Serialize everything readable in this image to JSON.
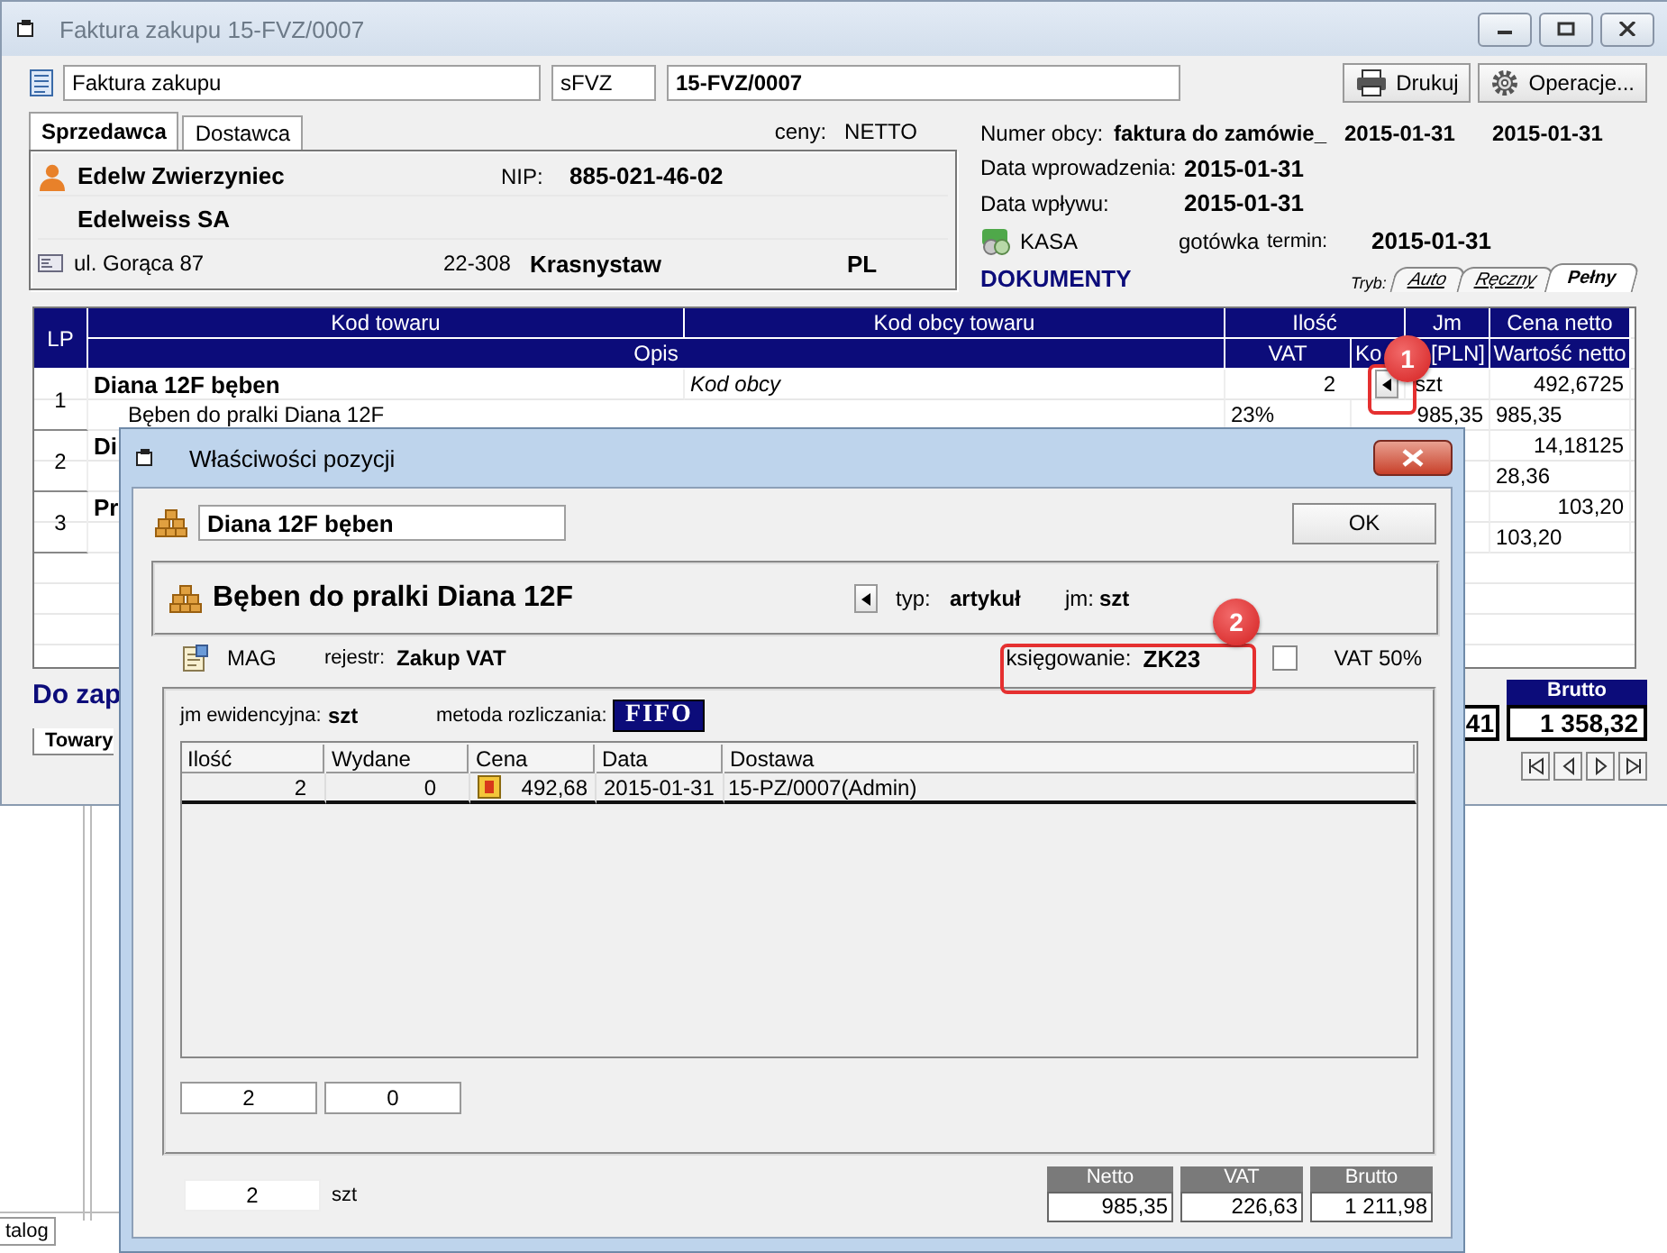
{
  "window": {
    "title": "Faktura zakupu 15-FVZ/0007"
  },
  "header": {
    "doc_type": "Faktura zakupu",
    "series": "sFVZ",
    "number": "15-FVZ/0007",
    "buttons": [
      {
        "kind": "print",
        "label": "Drukuj"
      },
      {
        "kind": "operations",
        "label": "Operacje..."
      }
    ]
  },
  "party_tabs": [
    {
      "label": "Sprzedawca",
      "selected": true
    },
    {
      "label": "Dostawca",
      "selected": false
    }
  ],
  "prices": {
    "label": "ceny:",
    "value": "NETTO"
  },
  "seller": {
    "name": "Edelw Zwierzyniec",
    "nip_label": "NIP:",
    "nip": "885-021-46-02",
    "full_name": "Edelweiss SA",
    "street": "ul. Gorąca 87",
    "postcode": "22-308",
    "city": "Krasnystaw",
    "country": "PL"
  },
  "doc_info": {
    "foreign_label": "Numer obcy:",
    "foreign_number": "faktura do zamówie_",
    "foreign_date_1": "2015-01-31",
    "foreign_date_2": "2015-01-31",
    "entry_label": "Data wprowadzenia:",
    "entry_date": "2015-01-31",
    "receipt_label": "Data wpływu:",
    "receipt_date": "2015-01-31",
    "cash_register": "KASA",
    "payment": "gotówka",
    "due_label": "termin:",
    "due_date": "2015-01-31"
  },
  "documents_label": "DOKUMENTY",
  "mode_label": "Tryb:",
  "mode_tabs": [
    {
      "label": "Auto",
      "selected": false
    },
    {
      "label": "Ręczny",
      "selected": false
    },
    {
      "label": "Pełny",
      "selected": true
    }
  ],
  "table": {
    "columns_top": [
      "LP",
      "Kod towaru",
      "Kod obcy towaru",
      "Ilość",
      "Jm",
      "Cena netto"
    ],
    "columns_bottom": [
      "Opis",
      "VAT",
      {
        "start": "Ko",
        "end": "[PLN]"
      },
      "Wartość netto"
    ],
    "rows": [
      {
        "lp": "1",
        "code": "Diana 12F bęben",
        "foreign_code": "Kod obcy",
        "qty": "2",
        "unit": "szt",
        "price": "492,6725",
        "description": "Bęben do pralki Diana 12F",
        "vat": "23%",
        "cost": "985,35",
        "value": "985,35"
      },
      {
        "lp": "2",
        "code": "Di",
        "price": "14,18125",
        "value": "28,36"
      },
      {
        "lp": "3",
        "code": "Pr",
        "price": "103,20",
        "value": "103,20"
      }
    ]
  },
  "to_pay_label": "Do zap",
  "totals": [
    {
      "value": "41"
    },
    {
      "label": "Brutto",
      "value": "1 358,32"
    }
  ],
  "bottom_tabs": [
    {
      "label": "Towary",
      "selected": true
    }
  ],
  "background_window": {
    "tab": "talog"
  },
  "dialog": {
    "title": "Właściwości pozycji",
    "code": "Diana 12F bęben",
    "ok": "OK",
    "name": "Bęben do pralki Diana 12F",
    "type_label": "typ:",
    "type": "artykuł",
    "unit_label": "jm:",
    "unit": "szt",
    "warehouse": "MAG",
    "register_label": "rejestr:",
    "register": "Zakup VAT",
    "posting_label": "księgowanie:",
    "posting": "ZK23",
    "vat50": {
      "label": "VAT 50%",
      "checked": false
    },
    "stock_unit_label": "jm ewidencyjna:",
    "stock_unit": "szt",
    "method_label": "metoda rozliczania:",
    "method": "FIFO",
    "columns": [
      "Ilość",
      "Wydane",
      "Cena",
      "Data",
      "Dostawa"
    ],
    "rows": [
      {
        "qty": "2",
        "issued": "0",
        "price": "492,68",
        "date": "2015-01-31",
        "delivery": "15-PZ/0007(Admin)"
      }
    ],
    "column_totals": [
      "2",
      "0"
    ],
    "quantity": "2",
    "quantity_unit": "szt",
    "summary": [
      {
        "label": "Netto",
        "value": "985,35"
      },
      {
        "label": "VAT",
        "value": "226,63"
      },
      {
        "label": "Brutto",
        "value": "1 211,98"
      }
    ]
  },
  "annotations": [
    {
      "label": "1"
    },
    {
      "label": "2"
    }
  ]
}
